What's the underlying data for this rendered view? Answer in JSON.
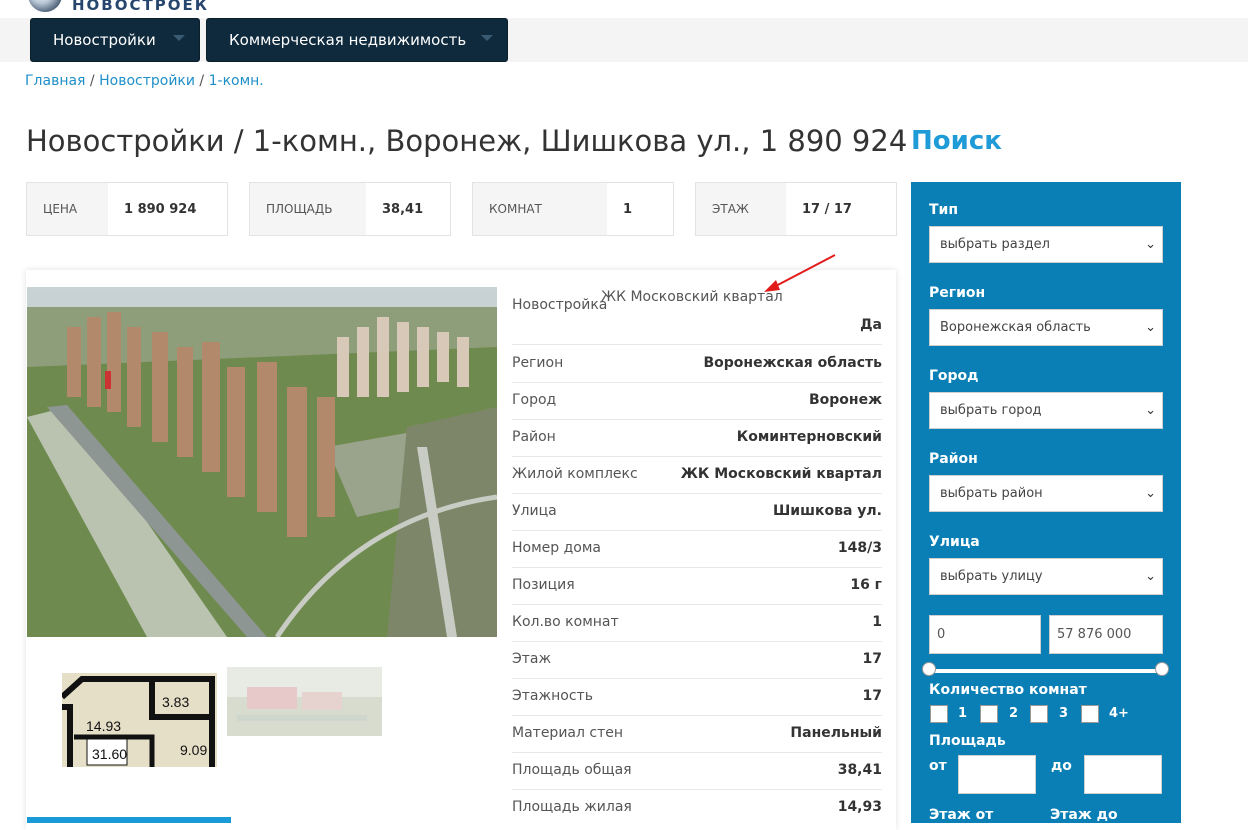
{
  "logo": {
    "text": "НОВОСТРОЕК"
  },
  "nav": [
    {
      "label": "Новостройки"
    },
    {
      "label": "Коммерческая недвижимость"
    }
  ],
  "breadcrumb": {
    "home": "Главная",
    "sep1": " / ",
    "section": "Новостройки",
    "sep2": " / ",
    "current": "1-комн."
  },
  "page_title": "Новостройки / 1-комн., Воронеж, Шишкова ул., 1 890 924",
  "stats": [
    {
      "label": "ЦЕНА",
      "value": "1 890 924"
    },
    {
      "label": "ПЛОЩАДЬ",
      "value": "38,41"
    },
    {
      "label": "КОМНАТ",
      "value": "1"
    },
    {
      "label": "ЭТАЖ",
      "value": "17 / 17"
    }
  ],
  "annotation": "ЖК Московский квартал",
  "details": [
    {
      "key": "Новостройка",
      "value": "Да"
    },
    {
      "key": "Регион",
      "value": "Воронежская область"
    },
    {
      "key": "Город",
      "value": "Воронеж"
    },
    {
      "key": "Район",
      "value": "Коминтерновский"
    },
    {
      "key": "Жилой комплекс",
      "value": "ЖК Московский квартал"
    },
    {
      "key": "Улица",
      "value": "Шишкова ул."
    },
    {
      "key": "Номер дома",
      "value": "148/3"
    },
    {
      "key": "Позиция",
      "value": "16 г"
    },
    {
      "key": "Кол.во комнат",
      "value": "1"
    },
    {
      "key": "Этаж",
      "value": "17"
    },
    {
      "key": "Этажность",
      "value": "17"
    },
    {
      "key": "Материал стен",
      "value": "Панельный"
    },
    {
      "key": "Площадь общая",
      "value": "38,41"
    },
    {
      "key": "Площадь жилая",
      "value": "14,93"
    }
  ],
  "floorplan": {
    "room1": "14.93",
    "room2": "3.83",
    "room3": "31.60",
    "room4": "9.09"
  },
  "search": {
    "title": "Поиск",
    "type_label": "Тип",
    "type_value": "выбрать раздел",
    "region_label": "Регион",
    "region_value": "Воронежская область",
    "city_label": "Город",
    "city_value": "выбрать город",
    "district_label": "Район",
    "district_value": "выбрать район",
    "street_label": "Улица",
    "street_value": "выбрать улицу",
    "price_min": "0",
    "price_max": "57 876 000",
    "rooms_label": "Количество комнат",
    "rooms": [
      "1",
      "2",
      "3",
      "4+"
    ],
    "area_label": "Площадь",
    "from_label": "от",
    "to_label": "до",
    "floor_from_label": "Этаж от",
    "floor_to_label": "Этаж до"
  },
  "colors": {
    "nav_bg": "#0f2a3d",
    "link": "#1f8fc9",
    "search_panel": "#0a7fb5",
    "search_title": "#1f9bd7"
  }
}
